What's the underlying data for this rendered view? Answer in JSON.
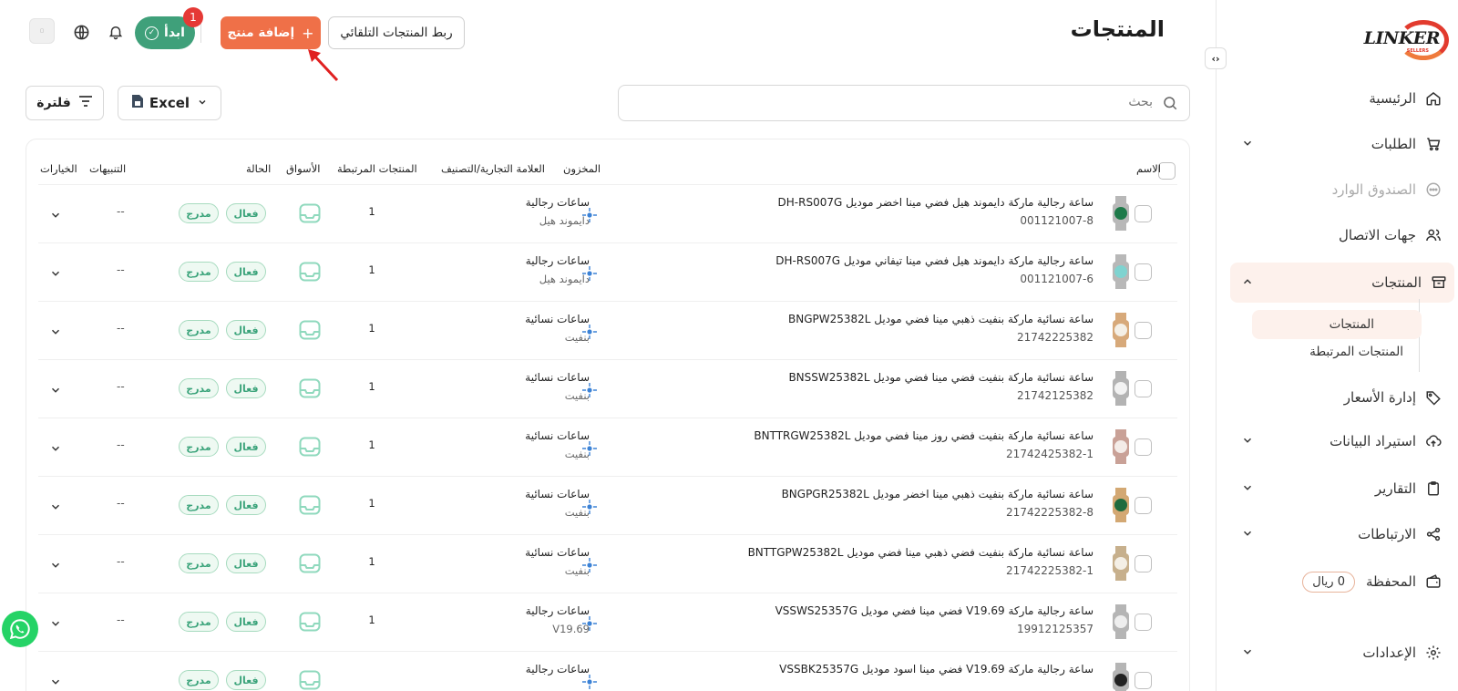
{
  "header": {
    "title": "المنتجات",
    "link_button": "ربط المنتجات التلقائي",
    "add_button": "إضافة منتج",
    "start_button": "ابدأ",
    "notification_count": "1"
  },
  "sidebar": {
    "logo_text": "LINKER",
    "logo_sub": "SELLERS",
    "items": [
      {
        "label": "الرئيسية"
      },
      {
        "label": "الطلبات"
      },
      {
        "label": "الصندوق الوارد"
      },
      {
        "label": "جهات الاتصال"
      },
      {
        "label": "المنتجات"
      },
      {
        "label": "إدارة الأسعار"
      },
      {
        "label": "استيراد البيانات"
      },
      {
        "label": "التقارير"
      },
      {
        "label": "الارتباطات"
      },
      {
        "label": "المحفظة"
      },
      {
        "label": "الإعدادات"
      }
    ],
    "sub_items": [
      {
        "label": "المنتجات"
      },
      {
        "label": "المنتجات المرتبطة"
      }
    ],
    "wallet_balance": "0 ريال"
  },
  "toolbar": {
    "search_placeholder": "بحث",
    "excel_label": "Excel",
    "filter_label": "فلترة"
  },
  "table": {
    "headers": {
      "name": "الاسم",
      "stock": "المخزون",
      "brand": "العلامة التجارية/التصنيف",
      "linked": "المنتجات المرتبطة",
      "markets": "الأسواق",
      "status": "الحالة",
      "alerts": "التنبيهات",
      "options": "الخيارات"
    },
    "rows": [
      {
        "name": "ساعة رجالية ماركة دايموند هيل فضي مينا اخضر موديل DH-RS007G",
        "sku": "001121007-8",
        "category": "ساعات رجالية",
        "brand": "دايموند هيل",
        "linked": "1",
        "active": "فعال",
        "listed": "مدرج",
        "alerts": "--",
        "dial": "#1e7a4a",
        "strap": "#b8b8b8"
      },
      {
        "name": "ساعة رجالية ماركة دايموند هيل فضي مينا تيفاني موديل DH-RS007G",
        "sku": "001121007-6",
        "category": "ساعات رجالية",
        "brand": "دايموند هيل",
        "linked": "1",
        "active": "فعال",
        "listed": "مدرج",
        "alerts": "--",
        "dial": "#7fd3d0",
        "strap": "#b8b8b8"
      },
      {
        "name": "ساعة نسائية ماركة بنفيت ذهبي مينا فضي موديل BNGPW25382L",
        "sku": "21742225382",
        "category": "ساعات نسائية",
        "brand": "بنفيت",
        "linked": "1",
        "active": "فعال",
        "listed": "مدرج",
        "alerts": "--",
        "dial": "#f4efe6",
        "strap": "#d7a97a"
      },
      {
        "name": "ساعة نسائية ماركة بنفيت فضي مينا فضي موديل BNSSW25382L",
        "sku": "21742125382",
        "category": "ساعات نسائية",
        "brand": "بنفيت",
        "linked": "1",
        "active": "فعال",
        "listed": "مدرج",
        "alerts": "--",
        "dial": "#f2f2f2",
        "strap": "#b3b3b3"
      },
      {
        "name": "ساعة نسائية ماركة بنفيت فضي روز مينا فضي موديل BNTTRGW25382L",
        "sku": "21742425382-1",
        "category": "ساعات نسائية",
        "brand": "بنفيت",
        "linked": "1",
        "active": "فعال",
        "listed": "مدرج",
        "alerts": "--",
        "dial": "#f4ece8",
        "strap": "#c9a197"
      },
      {
        "name": "ساعة نسائية ماركة بنفيت ذهبي مينا اخضر موديل BNGPGR25382L",
        "sku": "21742225382-8",
        "category": "ساعات نسائية",
        "brand": "بنفيت",
        "linked": "1",
        "active": "فعال",
        "listed": "مدرج",
        "alerts": "--",
        "dial": "#1f6b3e",
        "strap": "#d3a873"
      },
      {
        "name": "ساعة نسائية ماركة بنفيت فضي ذهبي مينا فضي موديل BNTTGPW25382L",
        "sku": "21742225382-1",
        "category": "ساعات نسائية",
        "brand": "بنفيت",
        "linked": "1",
        "active": "فعال",
        "listed": "مدرج",
        "alerts": "--",
        "dial": "#f4efe6",
        "strap": "#c7b08d"
      },
      {
        "name": "ساعة رجالية ماركة V19.69 فضي مينا فضي موديل VSSWS25357G",
        "sku": "19912125357",
        "category": "ساعات رجالية",
        "brand": "V19.69",
        "linked": "1",
        "active": "فعال",
        "listed": "مدرج",
        "alerts": "--",
        "dial": "#eeeeee",
        "strap": "#b5b5b5"
      },
      {
        "name": "ساعة رجالية ماركة V19.69 فضي مينا اسود موديل VSSBK25357G",
        "sku": "",
        "category": "ساعات رجالية",
        "brand": "",
        "linked": "",
        "active": "فعال",
        "listed": "مدرج",
        "alerts": "",
        "dial": "#222222",
        "strap": "#b5b5b5"
      }
    ]
  },
  "colors": {
    "accent": "#ef7048",
    "start": "#3fa07a",
    "badge": "#e53935",
    "pill_text": "#3aa37a",
    "store_icon": "#3b82d6",
    "market_icon": "#8fd9bd"
  }
}
